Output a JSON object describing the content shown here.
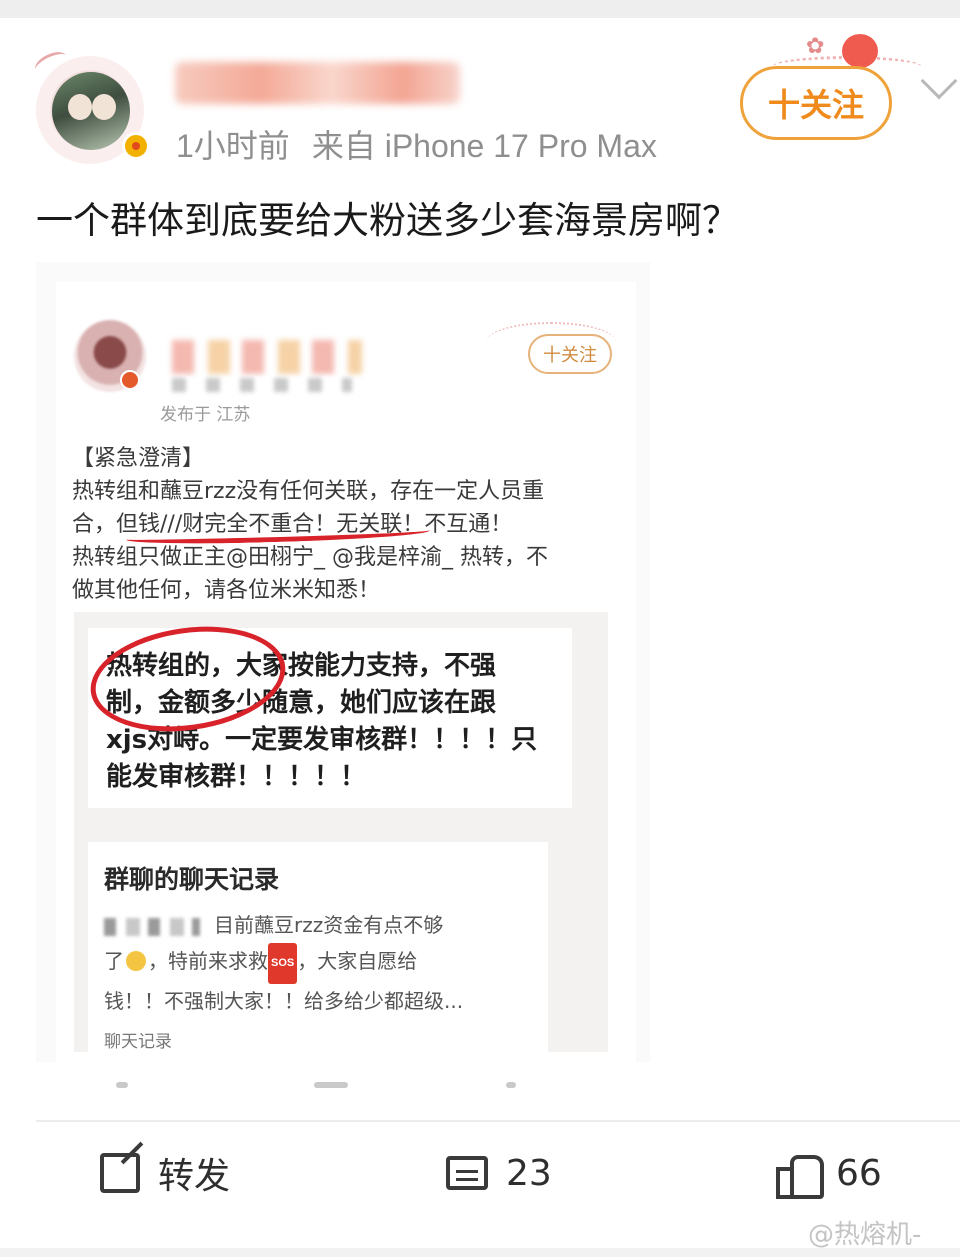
{
  "header": {
    "post_time": "1小时前",
    "post_source": "来自 iPhone 17 Pro Max",
    "follow_label": "十关注"
  },
  "post": {
    "text": "一个群体到底要给大粉送多少套海景房啊？"
  },
  "embedded_post": {
    "location": "发布于 江苏",
    "follow_label": "十关注",
    "body_lines": [
      "【紧急澄清】",
      "热转组和蘸豆rzz没有任何关联，存在一定人员重",
      "合，但钱///财完全不重合！无关联！不互通！",
      "热转组只做正主@田栩宁_ @我是梓渝_ 热转，不",
      "做其他任何，请各位米米知悉！"
    ],
    "quote_lines": [
      "热转组的，大家按能力支持，不强",
      "制，金额多少随意，她们应该在跟",
      "xjs对峙。一定要发审核群！！！！只",
      "能发审核群！！！！！"
    ],
    "chat_title": "群聊的聊天记录",
    "chat_line1": "目前蘸豆rzz资金有点不够",
    "chat_line2a": "了",
    "chat_line2b": "，特前来求救",
    "chat_line2c": "，大家自愿给",
    "chat_line3": "钱！！不强制大家！！给多给少都超级...",
    "sos": "SOS",
    "chat_label": "聊天记录"
  },
  "actions": {
    "repost_label": "转发",
    "comment_count": "23",
    "like_count": "66"
  },
  "watermark": "@热熔机-",
  "icons": [
    "chevron-down-icon",
    "repost-icon",
    "comment-icon",
    "like-icon",
    "vip-badge-icon"
  ],
  "colors": {
    "follow_orange": "#f08a1c",
    "annotation_red": "#d8232a"
  }
}
